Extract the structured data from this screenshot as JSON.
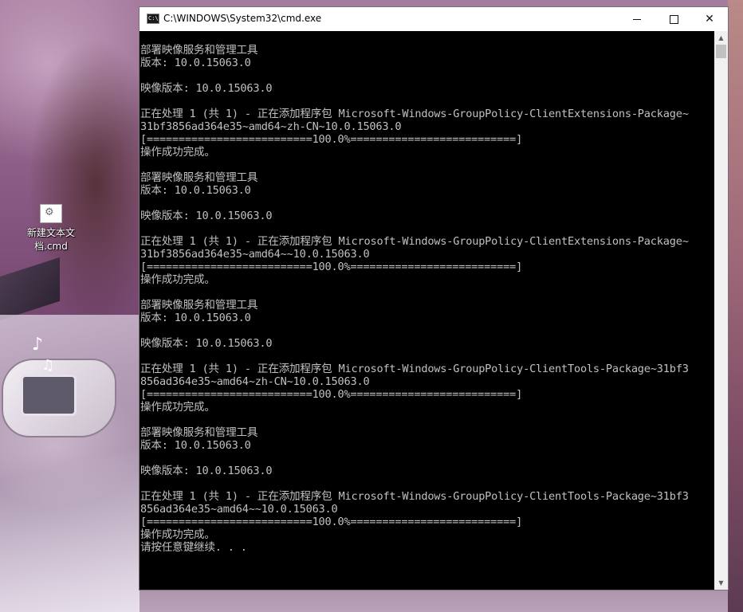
{
  "desktop": {
    "icon_label_line1": "新建文本文",
    "icon_label_line2": "档.cmd"
  },
  "window": {
    "title": "C:\\WINDOWS\\System32\\cmd.exe",
    "minimize_symbol": "—",
    "maximize_symbol": "☐",
    "close_symbol": "✕",
    "colors": {
      "console_background": "#000000",
      "console_text": "#c0c0c0",
      "titlebar": "#ffffff"
    }
  },
  "console": {
    "lines": [
      "部署映像服务和管理工具",
      "版本: 10.0.15063.0",
      "",
      "映像版本: 10.0.15063.0",
      "",
      "正在处理 1 (共 1) - 正在添加程序包 Microsoft-Windows-GroupPolicy-ClientExtensions-Package~",
      "31bf3856ad364e35~amd64~zh-CN~10.0.15063.0",
      "[==========================100.0%==========================]",
      "操作成功完成。",
      "",
      "部署映像服务和管理工具",
      "版本: 10.0.15063.0",
      "",
      "映像版本: 10.0.15063.0",
      "",
      "正在处理 1 (共 1) - 正在添加程序包 Microsoft-Windows-GroupPolicy-ClientExtensions-Package~",
      "31bf3856ad364e35~amd64~~10.0.15063.0",
      "[==========================100.0%==========================]",
      "操作成功完成。",
      "",
      "部署映像服务和管理工具",
      "版本: 10.0.15063.0",
      "",
      "映像版本: 10.0.15063.0",
      "",
      "正在处理 1 (共 1) - 正在添加程序包 Microsoft-Windows-GroupPolicy-ClientTools-Package~31bf3",
      "856ad364e35~amd64~zh-CN~10.0.15063.0",
      "[==========================100.0%==========================]",
      "操作成功完成。",
      "",
      "部署映像服务和管理工具",
      "版本: 10.0.15063.0",
      "",
      "映像版本: 10.0.15063.0",
      "",
      "正在处理 1 (共 1) - 正在添加程序包 Microsoft-Windows-GroupPolicy-ClientTools-Package~31bf3",
      "856ad364e35~amd64~~10.0.15063.0",
      "[==========================100.0%==========================]",
      "操作成功完成。",
      "请按任意键继续. . ."
    ]
  },
  "scrollbar": {
    "up_arrow": "▲",
    "down_arrow": "▼"
  }
}
